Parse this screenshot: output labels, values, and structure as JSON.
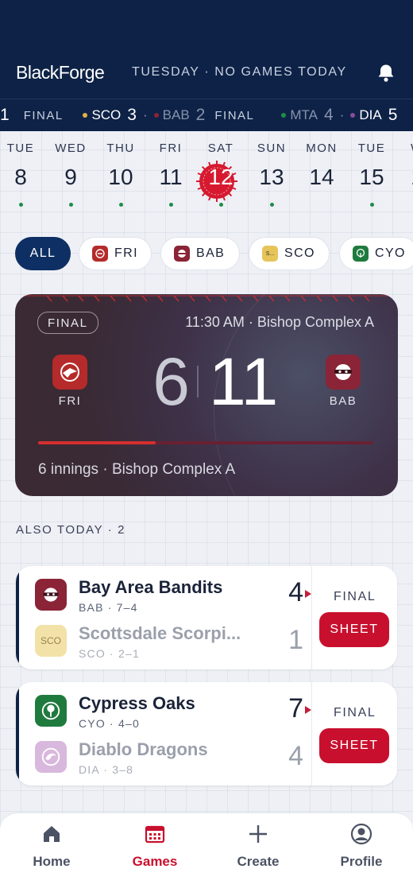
{
  "header": {
    "logo": "BlackForge",
    "status": "TUESDAY · NO GAMES TODAY",
    "bell_icon": "bell-icon"
  },
  "ticker": [
    {
      "lead": "1",
      "status": "FINAL"
    },
    {
      "team1": "SCO",
      "score1": "3",
      "team2": "BAB",
      "score2": "2",
      "status": "FINAL",
      "color1": "#e0b04a",
      "color2": "#8a2436"
    },
    {
      "team1": "MTA",
      "score1": "4",
      "team2": "DIA",
      "score2": "5",
      "color1": "#1f8c4a",
      "color2": "#8a4a9a"
    }
  ],
  "dates": [
    {
      "dow": "TUE",
      "num": "8",
      "has_game": true
    },
    {
      "dow": "WED",
      "num": "9",
      "has_game": true
    },
    {
      "dow": "THU",
      "num": "10",
      "has_game": true
    },
    {
      "dow": "FRI",
      "num": "11",
      "has_game": true
    },
    {
      "dow": "SAT",
      "num": "12",
      "has_game": true,
      "selected": true
    },
    {
      "dow": "SUN",
      "num": "13",
      "has_game": true
    },
    {
      "dow": "MON",
      "num": "14",
      "has_game": false
    },
    {
      "dow": "TUE",
      "num": "15",
      "has_game": true
    },
    {
      "dow": "W",
      "num": "1",
      "has_game": false
    }
  ],
  "filters": [
    {
      "label": "ALL",
      "active": true
    },
    {
      "label": "FRI",
      "icon": "fri-logo-icon",
      "color": "#b52a2a"
    },
    {
      "label": "BAB",
      "icon": "bab-logo-icon",
      "color": "#8a2436"
    },
    {
      "label": "SCO",
      "icon": "sco-logo-icon",
      "icon_text": "S...",
      "color": "#e6c45a"
    },
    {
      "label": "CYO",
      "icon": "cyo-logo-icon",
      "color": "#1f7a3e"
    }
  ],
  "hero": {
    "status": "FINAL",
    "time_venue": "11:30 AM · Bishop Complex A",
    "home_abbr": "FRI",
    "away_abbr": "BAB",
    "home_score": "6",
    "away_score": "11",
    "progress": 0.35,
    "footer": "6 innings · Bishop Complex A"
  },
  "also_today": "ALSO TODAY · 2",
  "games": [
    {
      "winner": {
        "name": "Bay Area Bandits",
        "record": "BAB · 7–4",
        "score": "4",
        "logo": "bab-logo-icon"
      },
      "loser": {
        "name": "Scottsdale Scorpi...",
        "record": "SCO · 2–1",
        "score": "1",
        "logo": "sco-logo-icon",
        "logo_text": "SCO"
      },
      "status": "FINAL",
      "action": "SHEET"
    },
    {
      "winner": {
        "name": "Cypress Oaks",
        "record": "CYO · 4–0",
        "score": "7",
        "logo": "cyo-logo-icon"
      },
      "loser": {
        "name": "Diablo Dragons",
        "record": "DIA · 3–8",
        "score": "4",
        "logo": "dia-logo-icon"
      },
      "status": "FINAL",
      "action": "SHEET"
    }
  ],
  "nav": [
    {
      "label": "Home",
      "icon": "home-icon"
    },
    {
      "label": "Games",
      "icon": "calendar-icon",
      "active": true
    },
    {
      "label": "Create",
      "icon": "plus-icon"
    },
    {
      "label": "Profile",
      "icon": "profile-icon"
    }
  ],
  "colors": {
    "navy": "#0d2246",
    "accent_red": "#c8102e",
    "game_dot": "#1f8c4a"
  }
}
